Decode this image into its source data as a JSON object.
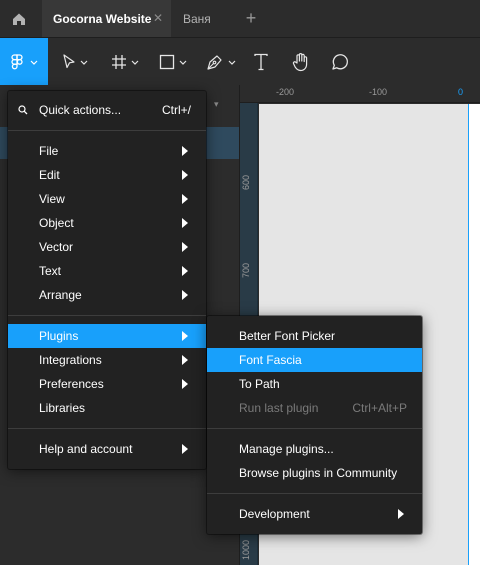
{
  "tabs": [
    {
      "label": "Gocorna Website",
      "active": true
    },
    {
      "label": "Ваня",
      "active": false
    }
  ],
  "tab_close_glyph": "✕",
  "tab_add_glyph": "+",
  "toolbar": {
    "tools": [
      "figma-menu-icon",
      "move-tool-icon",
      "frame-tool-icon",
      "shape-tool-icon",
      "pen-tool-icon",
      "text-tool-icon",
      "hand-tool-icon",
      "comment-tool-icon"
    ],
    "accent": "#18a0fb"
  },
  "ruler": {
    "top_ticks": [
      "-200",
      "-100",
      "0"
    ],
    "left_ticks": [
      "600",
      "700",
      "1000"
    ]
  },
  "main_menu": {
    "quick_actions": {
      "label": "Quick actions...",
      "shortcut": "Ctrl+/"
    },
    "group1": [
      {
        "label": "File"
      },
      {
        "label": "Edit"
      },
      {
        "label": "View"
      },
      {
        "label": "Object"
      },
      {
        "label": "Vector"
      },
      {
        "label": "Text"
      },
      {
        "label": "Arrange"
      }
    ],
    "group2": [
      {
        "label": "Plugins"
      },
      {
        "label": "Integrations"
      },
      {
        "label": "Preferences"
      },
      {
        "label": "Libraries"
      }
    ],
    "help": {
      "label": "Help and account"
    }
  },
  "plugins_menu": {
    "items": [
      {
        "label": "Better Font Picker"
      },
      {
        "label": "Font Fascia"
      },
      {
        "label": "To Path"
      },
      {
        "label": "Run last plugin",
        "shortcut": "Ctrl+Alt+P"
      }
    ],
    "manage": {
      "label": "Manage plugins..."
    },
    "browse": {
      "label": "Browse plugins in Community"
    },
    "development": {
      "label": "Development"
    }
  }
}
